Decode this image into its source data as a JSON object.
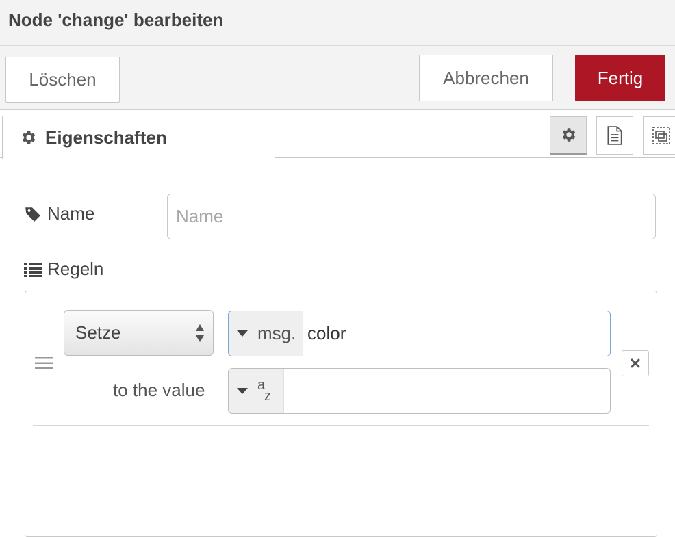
{
  "dialog": {
    "title": "Node 'change' bearbeiten"
  },
  "toolbar": {
    "delete_label": "Löschen",
    "cancel_label": "Abbrechen",
    "done_label": "Fertig"
  },
  "tabs": {
    "active_label": "Eigenschaften",
    "buttons": [
      "gear-icon",
      "document-icon",
      "frames-icon"
    ]
  },
  "form": {
    "name": {
      "label": "Name",
      "placeholder": "Name",
      "value": ""
    },
    "rules": {
      "label": "Regeln",
      "items": [
        {
          "action": "Setze",
          "property_type": "msg.",
          "property_value": "color",
          "to_label": "to the value",
          "value_type_icon": "az-string-icon",
          "value": ""
        }
      ]
    }
  },
  "colors": {
    "primary": "#ad1625",
    "focus_border": "#79a6d6",
    "toolbar_bg": "#f3f3f3"
  }
}
